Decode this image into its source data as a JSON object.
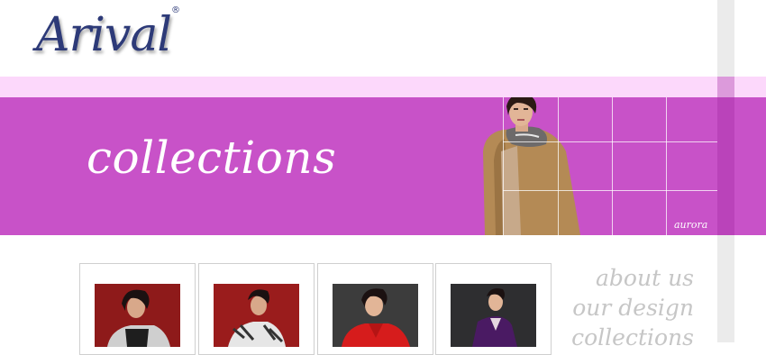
{
  "brand": {
    "name": "Arival",
    "registered": "®"
  },
  "banner": {
    "title": "collections",
    "caption": "aurora",
    "bg_color": "#c852c8"
  },
  "colors": {
    "band": "#fcd8fb",
    "nav_text": "#c6c6c6",
    "logo": "#2d3a78"
  },
  "products": [
    {
      "label": "collection-photo-1",
      "backdrop": "#8e1a1a",
      "garment": "#cfcfcf"
    },
    {
      "label": "collection-photo-2",
      "backdrop": "#9a1c1c",
      "garment": "#e6e6e6"
    },
    {
      "label": "collection-photo-3",
      "backdrop": "#3c3c3c",
      "garment": "#d61c1c"
    },
    {
      "label": "collection-photo-4",
      "backdrop": "#2e2e30",
      "garment": "#4a1a63"
    }
  ],
  "nav": [
    {
      "label": "about us"
    },
    {
      "label": "our design"
    },
    {
      "label": "collections"
    }
  ]
}
